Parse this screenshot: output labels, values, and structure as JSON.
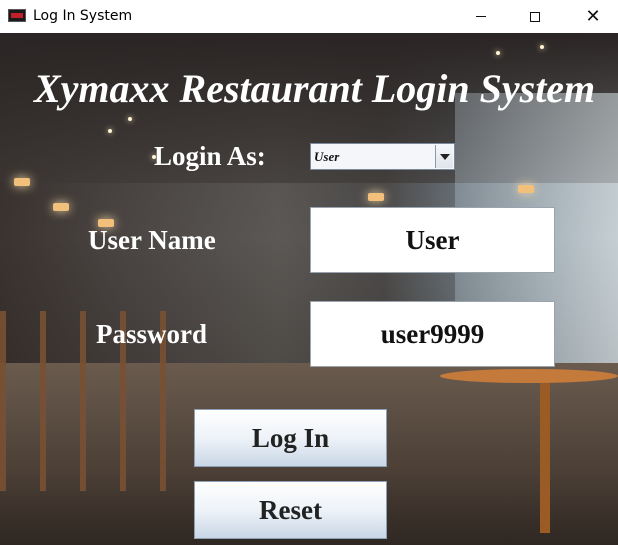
{
  "window": {
    "title": "Log In System"
  },
  "heading": "Xymaxx Restaurant Login System",
  "form": {
    "login_as_label": "Login As:",
    "login_as_value": "User",
    "username_label": "User Name",
    "username_value": "User",
    "password_label": "Password",
    "password_value": "user9999"
  },
  "buttons": {
    "login": "Log In",
    "reset": "Reset"
  },
  "icons": [
    "app-icon",
    "minimize-icon",
    "maximize-icon",
    "close-icon",
    "dropdown-arrow-icon"
  ]
}
